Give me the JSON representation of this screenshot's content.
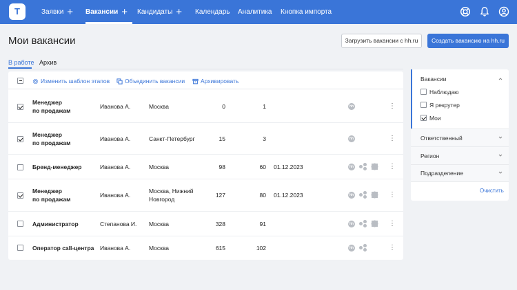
{
  "nav": {
    "logo_letter": "T",
    "items": [
      {
        "label": "Заявки"
      },
      {
        "label": "Вакансии"
      },
      {
        "label": "Кандидаты"
      },
      {
        "label": "Календарь"
      },
      {
        "label": "Аналитика"
      },
      {
        "label": "Кнопка импорта"
      }
    ],
    "plus": "+"
  },
  "page": {
    "title": "Мои вакансии",
    "load_button": "Загрузить вакансии с hh.ru",
    "create_button": "Создать вакансию на hh.ru",
    "tabs": [
      "В работе",
      "Архив"
    ]
  },
  "toolbar": {
    "change_template": "Изменить шаблон этапов",
    "merge": "Объединить вакансии",
    "archive": "Архивировать"
  },
  "rows": [
    {
      "name1": "Менеджер",
      "name2": "по продажам",
      "owner": "Иванова А.",
      "city1": "Москва",
      "city2": "",
      "a": "0",
      "b": "1",
      "date": "",
      "checked": true,
      "icons": "hh"
    },
    {
      "name1": "Менеджер",
      "name2": "по продажам",
      "owner": "Иванова А.",
      "city1": "Санкт-Петербург",
      "city2": "",
      "a": "15",
      "b": "3",
      "date": "",
      "checked": true,
      "icons": "hh"
    },
    {
      "name1": "Бренд-менеджер",
      "name2": "",
      "owner": "Иванова А.",
      "city1": "Москва",
      "city2": "",
      "a": "98",
      "b": "60",
      "date": "01.12.2023",
      "checked": false,
      "icons": "all"
    },
    {
      "name1": "Менеджер",
      "name2": "по продажам",
      "owner": "Иванова А.",
      "city1": "Москва, Нижний",
      "city2": "Новгород",
      "a": "127",
      "b": "80",
      "date": "01.12.2023",
      "checked": true,
      "icons": "all"
    },
    {
      "name1": "Администратор",
      "name2": "",
      "owner": "Степанова И.",
      "city1": "Москва",
      "city2": "",
      "a": "328",
      "b": "91",
      "date": "",
      "checked": false,
      "icons": "all"
    },
    {
      "name1": "Оператор call-центра",
      "name2": "",
      "owner": "Иванова А.",
      "city1": "Москва",
      "city2": "",
      "a": "615",
      "b": "102",
      "date": "",
      "checked": false,
      "icons": "dots"
    }
  ],
  "filter": {
    "vacancies_title": "Вакансии",
    "options": [
      {
        "label": "Наблюдаю",
        "checked": false
      },
      {
        "label": "Я рекрутер",
        "checked": false
      },
      {
        "label": "Мои",
        "checked": true
      }
    ],
    "sections": [
      "Ответственный",
      "Регион",
      "Подразделение"
    ],
    "clear": "Очистить"
  },
  "icon_text": {
    "hh": "hh"
  },
  "colors": {
    "brand": "#3a75d8",
    "icon_gray": "#b9bdc3"
  }
}
